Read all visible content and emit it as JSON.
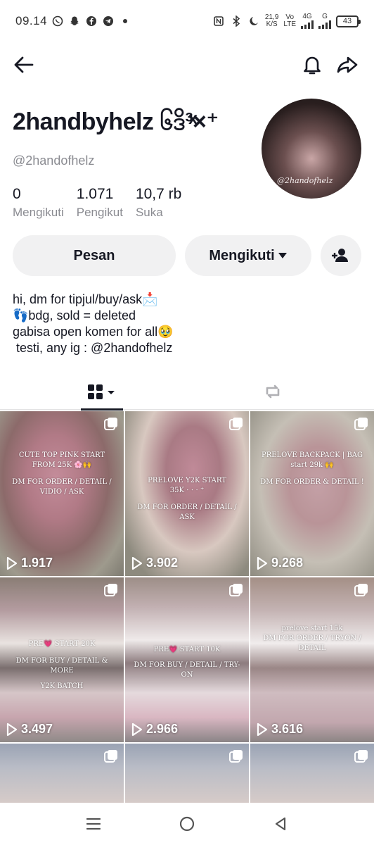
{
  "status_bar": {
    "time": "09.14",
    "speed_value": "21,9",
    "speed_unit": "K/S",
    "vo_label": "Vo",
    "lte_label": "LTE",
    "net_4g": "4G",
    "net_g": "G",
    "battery": "43"
  },
  "profile": {
    "display_name": "2handbyhelz ၆ဒိ³ͯ×⁺",
    "handle": "@2handofhelz",
    "avatar_watermark": "@2handofhelz",
    "stats": [
      {
        "value": "0",
        "label": "Mengikuti"
      },
      {
        "value": "1.071",
        "label": "Pengikut"
      },
      {
        "value": "10,7 rb",
        "label": "Suka"
      }
    ],
    "message_label": "Pesan",
    "following_label": "Mengikuti",
    "bio_lines": [
      "hi, dm for tipjul/buy/ask📩",
      "👣bdg, sold = deleted",
      "gabisa open komen for all🥹",
      " testi, any ig : @2handofhelz"
    ]
  },
  "videos": [
    {
      "views": "1.917",
      "text1": "CUTE TOP PINK START",
      "text2": "FROM 25K 🌸🙌",
      "text3": "DM FOR ORDER / DETAIL /",
      "text4": "VIDIO / ASK"
    },
    {
      "views": "3.902",
      "text1": "PRELOVE Y2K START",
      "text2": "35K ⋅ ⋅ ⋅ ⁺",
      "text3": "DM FOR ORDER / DETAIL / ASK",
      "text4": ""
    },
    {
      "views": "9.268",
      "text1": "PRELOVE BACKPACK | BAG",
      "text2": "start 29k 🙌",
      "text3": "DM FOR ORDER & DETAIL !",
      "text4": ""
    },
    {
      "views": "3.497",
      "text1": "PRE💗 START 20K",
      "text2": "DM FOR BUY / DETAIL &",
      "text3": "MORE",
      "text4": "Y2K BATCH"
    },
    {
      "views": "2.966",
      "text1": "PRE💗 START 10K",
      "text2": "DM FOR BUY / DETAIL / TRY-ON",
      "text3": "",
      "text4": ""
    },
    {
      "views": "3.616",
      "text1": "prelove start 15k",
      "text2": "DM FOR ORDER / TRYON / DETAIL",
      "text3": "",
      "text4": ""
    }
  ]
}
